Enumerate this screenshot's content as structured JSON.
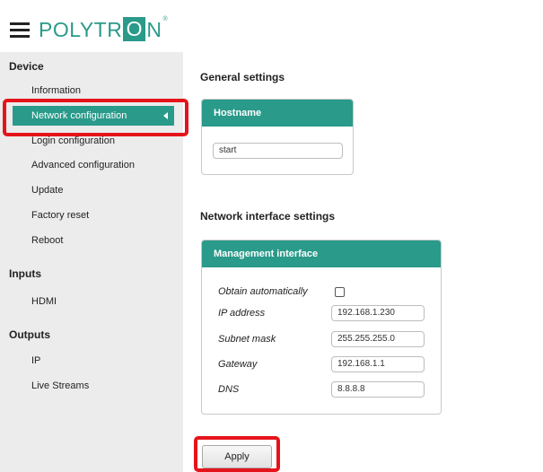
{
  "header": {
    "logo_before": "POLYTR",
    "logo_o": "O",
    "logo_after": "N",
    "logo_reg": "®"
  },
  "sidebar": {
    "device_title": "Device",
    "device_items": [
      "Information",
      "Network configuration",
      "Login configuration",
      "Advanced configuration",
      "Update",
      "Factory reset",
      "Reboot"
    ],
    "inputs_title": "Inputs",
    "inputs_items": [
      "HDMI"
    ],
    "outputs_title": "Outputs",
    "outputs_items": [
      "IP",
      "Live Streams"
    ],
    "active_item": "Network configuration"
  },
  "main": {
    "general_heading": "General settings",
    "hostname_panel_title": "Hostname",
    "hostname_value": "start",
    "network_heading": "Network interface settings",
    "mgmt_panel_title": "Management interface",
    "fields": {
      "obtain_label": "Obtain automatically",
      "obtain_checked": false,
      "ip_label": "IP address",
      "ip_value": "192.168.1.230",
      "subnet_label": "Subnet mask",
      "subnet_value": "255.255.255.0",
      "gateway_label": "Gateway",
      "gateway_value": "192.168.1.1",
      "dns_label": "DNS",
      "dns_value": "8.8.8.8"
    },
    "apply_label": "Apply"
  },
  "colors": {
    "accent": "#2a9a8a",
    "highlight": "#e5141b",
    "sidebar_bg": "#ececec"
  }
}
